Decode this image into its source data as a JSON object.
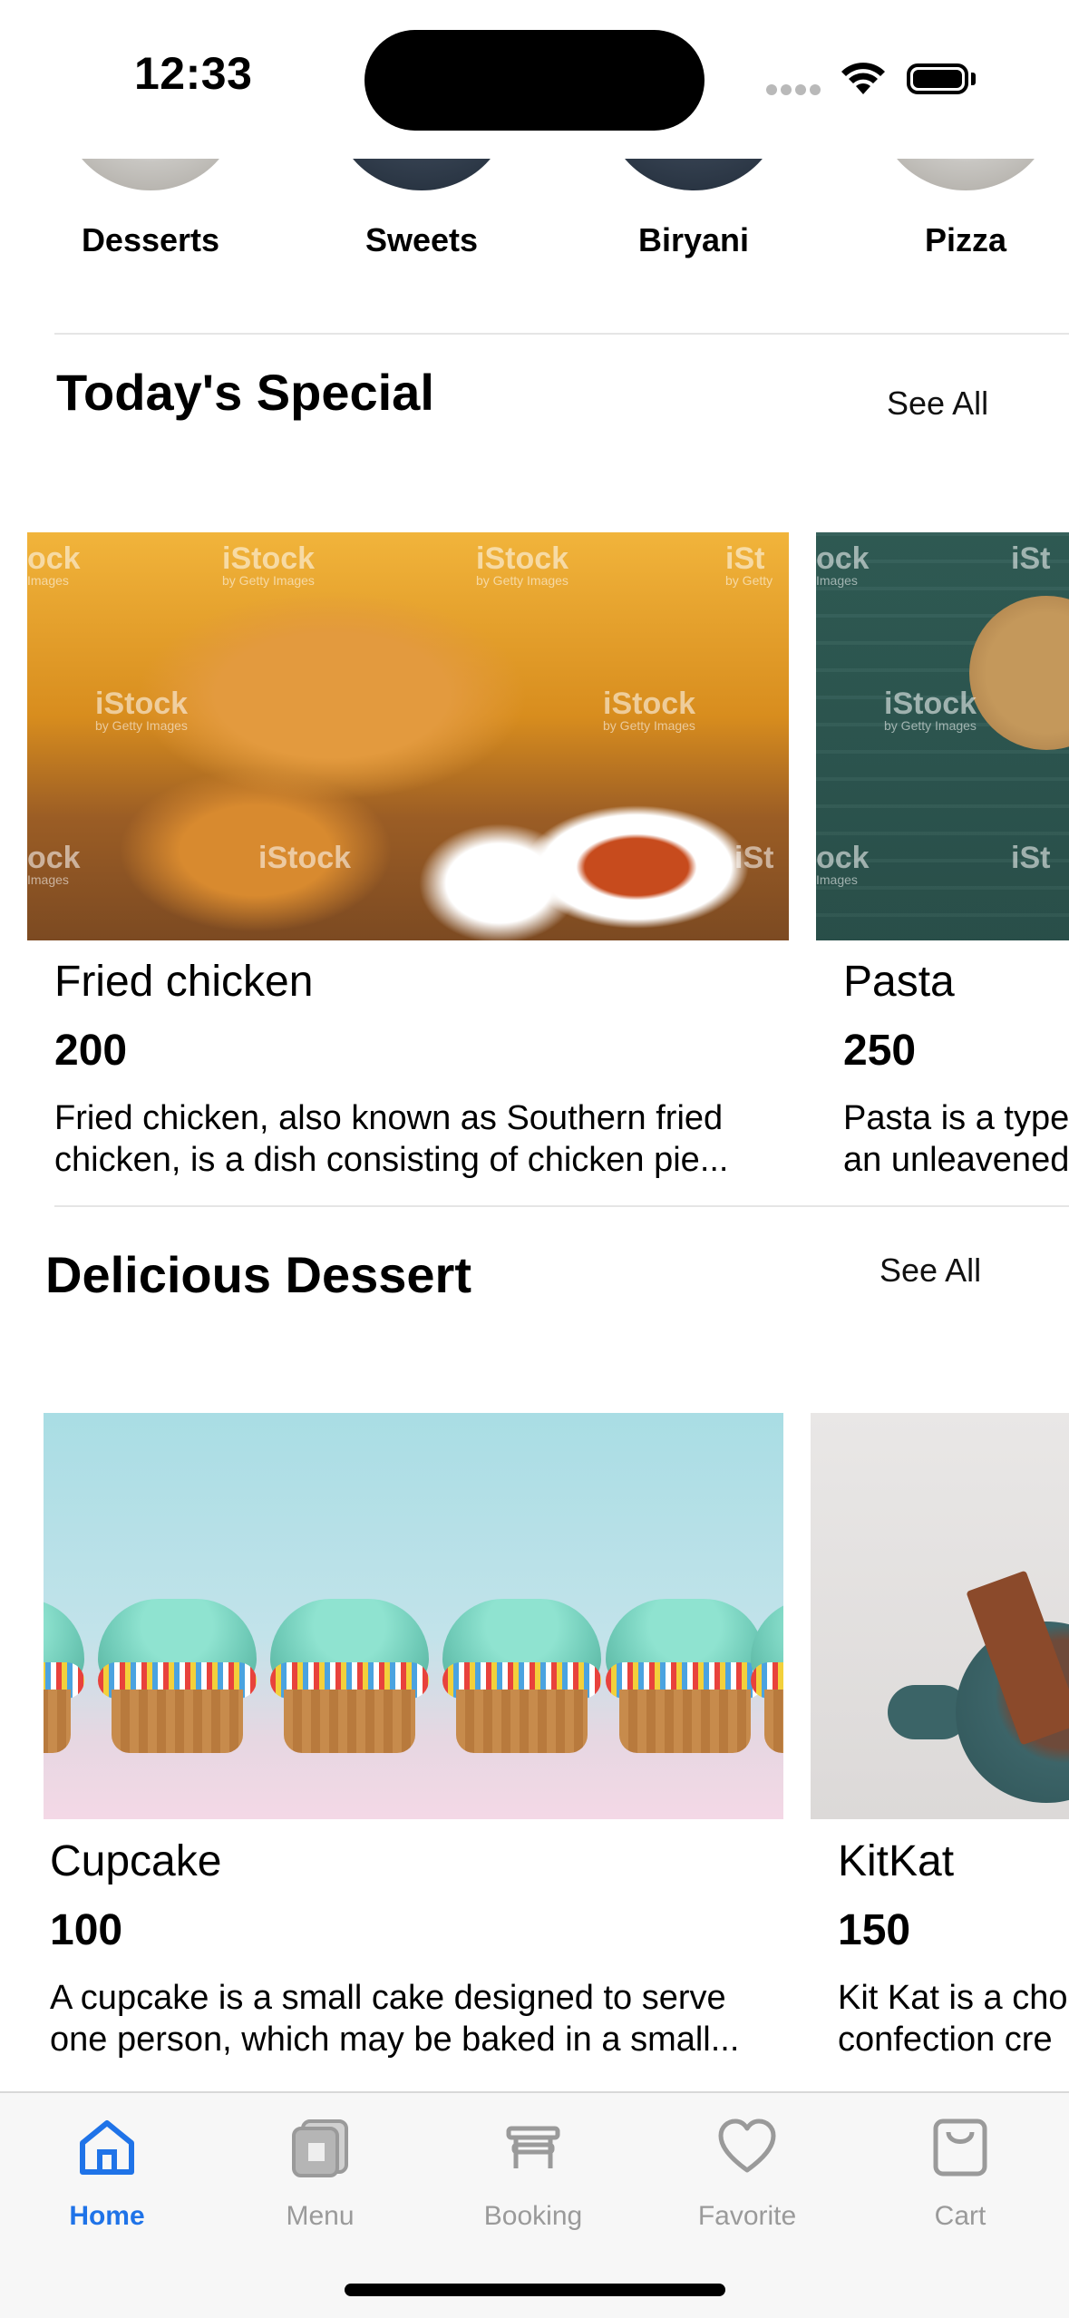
{
  "status_bar": {
    "time": "12:33"
  },
  "categories": [
    {
      "label": "Desserts",
      "style": "light"
    },
    {
      "label": "Sweets",
      "style": "dark"
    },
    {
      "label": "Biryani",
      "style": "dark"
    },
    {
      "label": "Pizza",
      "style": "light"
    }
  ],
  "todays_special": {
    "title": "Today's Special",
    "see_all": "See All",
    "items": [
      {
        "name": "Fried chicken",
        "price": "200",
        "desc_line1": "Fried chicken, also known as Southern fried",
        "desc_line2": "chicken, is a dish consisting of chicken pie..."
      },
      {
        "name": "Pasta",
        "price": "250",
        "desc_line1": "Pasta is a type",
        "desc_line2": "an unleavened"
      }
    ]
  },
  "delicious_dessert": {
    "title": "Delicious Dessert",
    "see_all": "See All",
    "items": [
      {
        "name": "Cupcake",
        "price": "100",
        "desc_line1": "A cupcake is a small cake designed to serve",
        "desc_line2": "one person, which may be baked in a small..."
      },
      {
        "name": "KitKat",
        "price": "150",
        "desc_line1": "Kit Kat is a cho",
        "desc_line2": "confection cre"
      }
    ]
  },
  "watermark": {
    "brand": "iStock",
    "sub": "by Getty Images"
  },
  "tab_bar": {
    "active_color": "#1f73e8",
    "inactive_color": "#9a9a9a",
    "tabs": [
      {
        "label": "Home",
        "icon": "home-icon",
        "active": true
      },
      {
        "label": "Menu",
        "icon": "menu-icon",
        "active": false
      },
      {
        "label": "Booking",
        "icon": "booking-icon",
        "active": false
      },
      {
        "label": "Favorite",
        "icon": "heart-icon",
        "active": false
      },
      {
        "label": "Cart",
        "icon": "cart-icon",
        "active": false
      }
    ]
  }
}
